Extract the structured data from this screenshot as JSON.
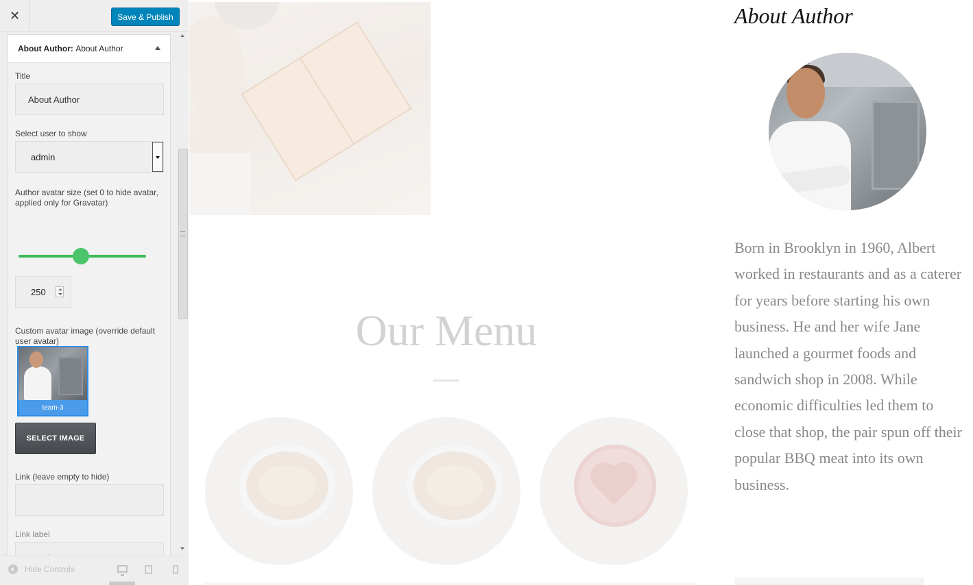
{
  "customizer": {
    "close_label": "✕",
    "publish_label": "Save & Publish",
    "section": {
      "type": "About Author:",
      "name": "About Author"
    },
    "fields": {
      "title_label": "Title",
      "title_value": "About Author",
      "user_label": "Select user to show",
      "user_value": "admin",
      "avatar_size_label": "Author avatar size (set 0 to hide avatar, applied only for Gravatar)",
      "avatar_size_value": "250",
      "custom_avatar_label": "Custom avatar image (override default user avatar)",
      "avatar_image_caption": "team-3",
      "select_image_label": "SELECT IMAGE",
      "link_label": "Link (leave empty to hide)",
      "link_value": "",
      "link_text_label": "Link label",
      "link_text_placeholder": "Read More"
    },
    "footer": {
      "hide_controls_label": "Hide Controls"
    }
  },
  "preview": {
    "menu_title": "Our Menu",
    "about_title": "About Author",
    "bio": "Born in Brooklyn in 1960, Albert worked in restaurants and as a caterer for years before starting his own business. He and her wife Jane launched a gourmet foods and sandwich shop in 2008. While economic difficulties led them to close that shop, the pair spun off their popular BBQ meat into its own business."
  },
  "colors": {
    "publish_button": "#0085ba",
    "slider": "#3cb95a",
    "selected_thumbnail": "#2e8ce6"
  }
}
